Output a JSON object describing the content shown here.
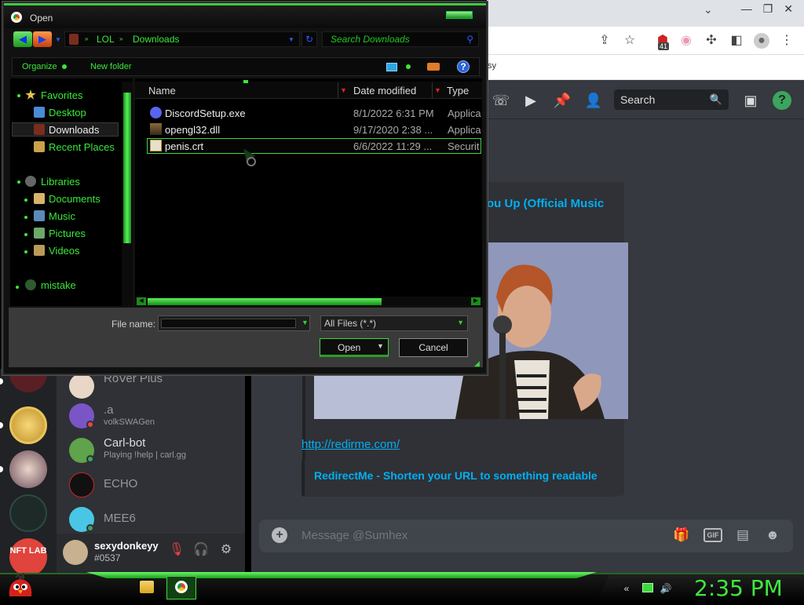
{
  "dialog": {
    "title": "Open",
    "address": {
      "segments": [
        "LOL",
        "Downloads"
      ]
    },
    "search_placeholder": "Search Downloads",
    "toolbar": {
      "organize": "Organize",
      "new_folder": "New folder",
      "help": "?"
    },
    "nav": {
      "favorites": "Favorites",
      "desktop": "Desktop",
      "downloads": "Downloads",
      "recent_places": "Recent Places",
      "libraries": "Libraries",
      "documents": "Documents",
      "music": "Music",
      "pictures": "Pictures",
      "videos": "Videos",
      "mistake": "mistake"
    },
    "columns": {
      "name": "Name",
      "date_modified": "Date modified",
      "type": "Type"
    },
    "files": [
      {
        "name": "DiscordSetup.exe",
        "date": "8/1/2022 6:31 PM",
        "type": "Applica"
      },
      {
        "name": "opengl32.dll",
        "date": "9/17/2020 2:38 ...",
        "type": "Applica"
      },
      {
        "name": "penis.crt",
        "date": "6/6/2022 11:29 ...",
        "type": "Securit"
      }
    ],
    "file_name_label": "File name:",
    "file_name_value": "",
    "file_type": "All Files (*.*)",
    "open_button": "Open",
    "cancel_button": "Cancel"
  },
  "chrome": {
    "extension_badge": "41",
    "bookmark_fragment": "sy"
  },
  "discord": {
    "search_placeholder": "Search",
    "help": "?",
    "embed_title": "ou Up (Official Music",
    "link": "http://redirme.com/",
    "link_embed_title": "RedirectMe - Shorten your URL to something readable",
    "message_placeholder": "Message @Sumhex",
    "gif_label": "GIF",
    "dms": [
      {
        "name": "RoVer Plus",
        "sub": ""
      },
      {
        "name": ".a",
        "sub": "volkSWAGen"
      },
      {
        "name": "Carl-bot",
        "sub": "Playing !help | carl.gg"
      },
      {
        "name": "ECHO",
        "sub": ""
      },
      {
        "name": "MEE6",
        "sub": ""
      }
    ],
    "user": {
      "name": "sexydonkeyy",
      "tag": "#0537"
    },
    "server_nft_label": "NFT LAB"
  },
  "taskbar": {
    "clock": "2:35 PM"
  },
  "colors": {
    "accent_green": "#39e839",
    "discord_link": "#00aff4",
    "discord_bg": "#36393f"
  }
}
